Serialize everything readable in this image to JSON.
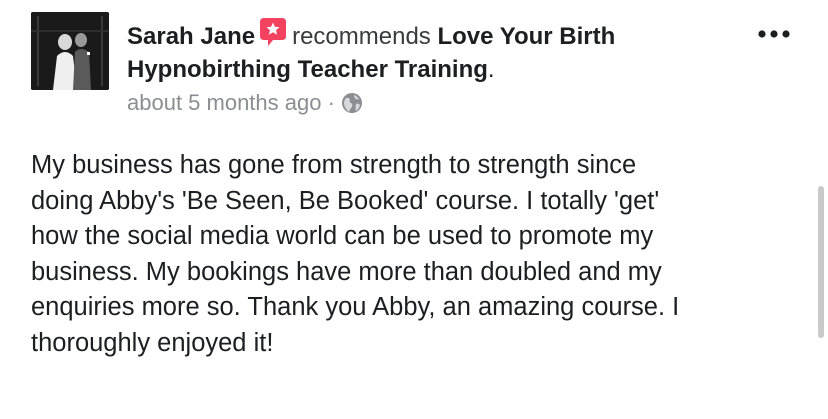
{
  "post": {
    "author": "Sarah Jane",
    "verb": "recommends",
    "page_name": "Love Your Birth Hypnobirthing Teacher Training",
    "period": ".",
    "timestamp": "about 5 months ago",
    "separator": "·",
    "privacy_icon": "globe-icon",
    "recommend_icon": "star-speech-bubble-icon",
    "more_icon": "more-options-icon",
    "body_text": "My business has gone from strength to strength since\ndoing Abby's 'Be Seen, Be Booked' course. I totally 'get'\nhow the social media world can be used to promote my\nbusiness. My bookings have more than doubled and my\nenquiries more so. Thank you Abby, an amazing course. I\nthoroughly enjoyed it!"
  },
  "colors": {
    "recommend_badge": "#f3425f",
    "meta_text": "#8a8d91",
    "primary_text": "#1c1e21",
    "scrollbar": "#c9c9c9"
  }
}
